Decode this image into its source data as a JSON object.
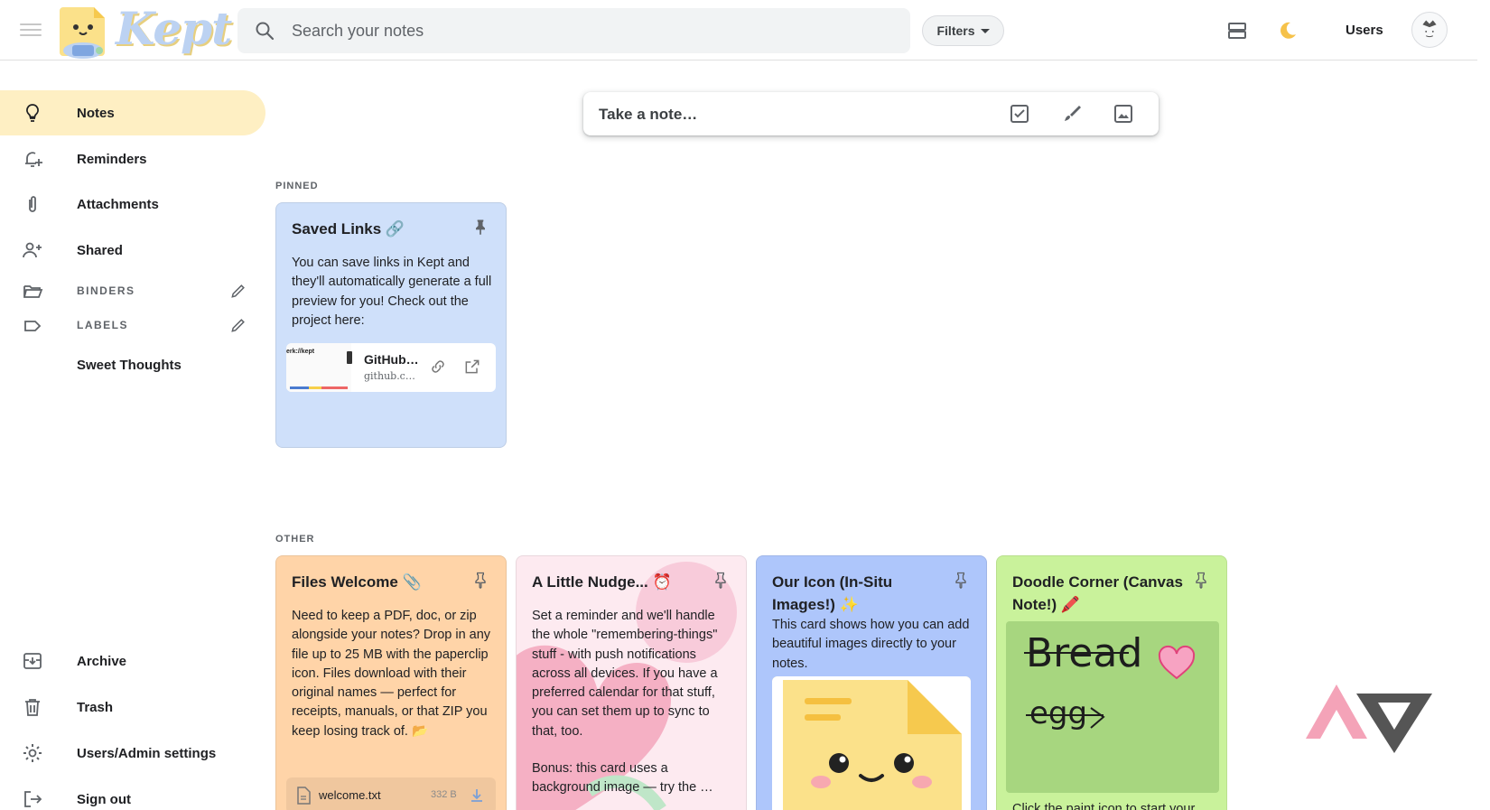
{
  "app": {
    "logo_text": "Kept",
    "accent_color": "#feefc3"
  },
  "header": {
    "search_placeholder": "Search your notes",
    "filters_label": "Filters",
    "users_label": "Users"
  },
  "sidebar": {
    "items": [
      {
        "label": "Notes",
        "icon": "lightbulb-icon",
        "active": true
      },
      {
        "label": "Reminders",
        "icon": "bell-plus-icon"
      },
      {
        "label": "Attachments",
        "icon": "paperclip-icon"
      },
      {
        "label": "Shared",
        "icon": "person-add-icon"
      }
    ],
    "binders_label": "BINDERS",
    "labels_label": "LABELS",
    "label_items": [
      "Sweet Thoughts"
    ],
    "bottom_items": [
      {
        "label": "Archive",
        "icon": "archive-icon"
      },
      {
        "label": "Trash",
        "icon": "trash-icon"
      },
      {
        "label": "Users/Admin settings",
        "icon": "gear-icon"
      },
      {
        "label": "Sign out",
        "icon": "sign-out-icon"
      }
    ]
  },
  "composer": {
    "placeholder": "Take a note…"
  },
  "sections": {
    "pinned": "PINNED",
    "other": "OTHER"
  },
  "pinned_notes": [
    {
      "title": "Saved Links 🔗",
      "body": "You can save links in Kept and they'll automatically generate a full preview for you! Check out the project here:",
      "color": "#cfe0fa",
      "link": {
        "thumb_text": "erk://kept",
        "title": "GitHub…",
        "url": "github.c…"
      }
    }
  ],
  "other_notes": [
    {
      "title": "Files Welcome 📎",
      "body": "Need to keep a PDF, doc, or zip alongside your notes? Drop in any file up to 25 MB with the paperclip icon. Files download with their original names — perfect for receipts, manuals, or that ZIP you keep losing track of. 📂",
      "color": "#ffd4a8",
      "file": {
        "name": "welcome.txt",
        "size": "332 B"
      }
    },
    {
      "title": "A Little Nudge... ⏰",
      "body": "Set a reminder and we'll handle the whole \"remembering-things\" stuff - with push notifications across all devices. If you have a preferred calendar for that stuff, you can set them up to sync to that, too.",
      "body2": "Bonus: this card uses a background image — try the …",
      "color": "#fdeaf0"
    },
    {
      "title": "Our Icon (In-Situ Images!) ✨",
      "body": "This card shows how you can add beautiful images directly to your notes.",
      "color": "#aec6fb"
    },
    {
      "title": "Doodle Corner (Canvas Note!) 🖍️",
      "body": "Click the paint icon to start your",
      "doodle_words": [
        "Bread",
        "egg"
      ],
      "color": "#c9f29b"
    }
  ]
}
